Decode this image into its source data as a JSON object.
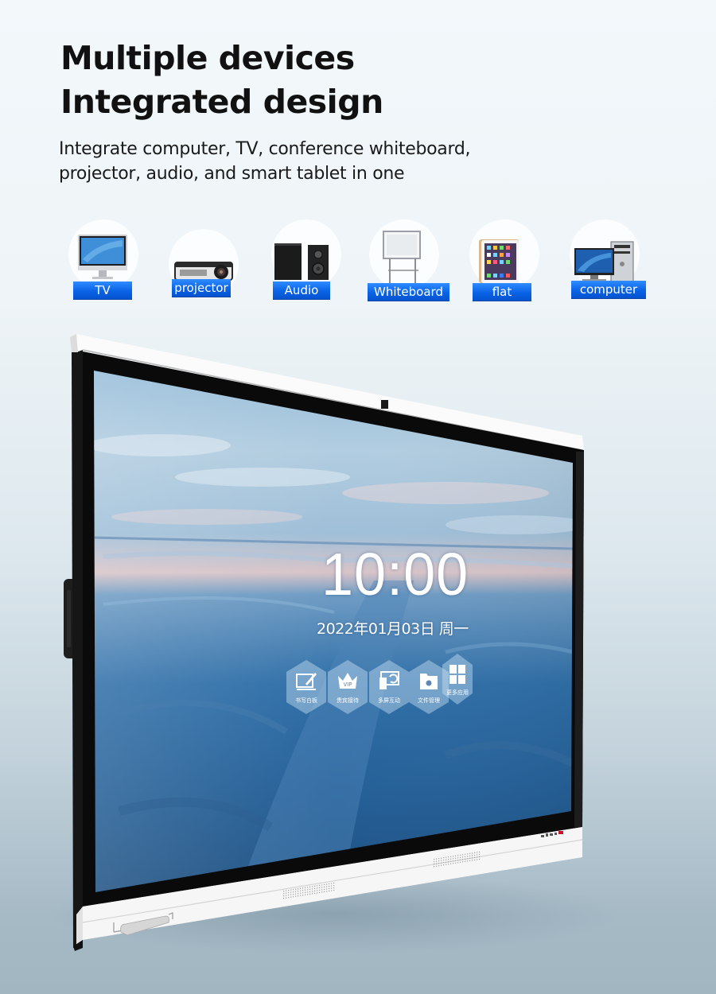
{
  "header": {
    "title_lines": [
      "Multiple devices",
      "Integrated design"
    ],
    "subtitle_lines": [
      "Integrate computer, TV, conference whiteboard,",
      "projector, audio, and smart tablet in one"
    ]
  },
  "devices": [
    {
      "label": "TV",
      "icon": "monitor-icon"
    },
    {
      "label": "projector",
      "icon": "projector-icon"
    },
    {
      "label": "Audio",
      "icon": "speakers-icon"
    },
    {
      "label": "Whiteboard",
      "icon": "whiteboard-icon"
    },
    {
      "label": "flat",
      "icon": "tablet-icon"
    },
    {
      "label": "computer",
      "icon": "desktop-computer-icon"
    }
  ],
  "screen": {
    "time": "10:00",
    "date": "2022年01月03日 周一",
    "apps": [
      {
        "label": "书写白板",
        "icon": "whiteboard-pen-icon"
      },
      {
        "label": "贵宾接待",
        "icon": "vip-crown-icon"
      },
      {
        "label": "多屏互动",
        "icon": "screen-share-icon"
      },
      {
        "label": "文件管理",
        "icon": "folder-gear-icon"
      },
      {
        "label": "更多应用",
        "icon": "app-grid-icon"
      }
    ]
  },
  "colors": {
    "badge_blue": "#0a63e6",
    "title_text": "#111111",
    "indicator_red": "#d0102a"
  }
}
